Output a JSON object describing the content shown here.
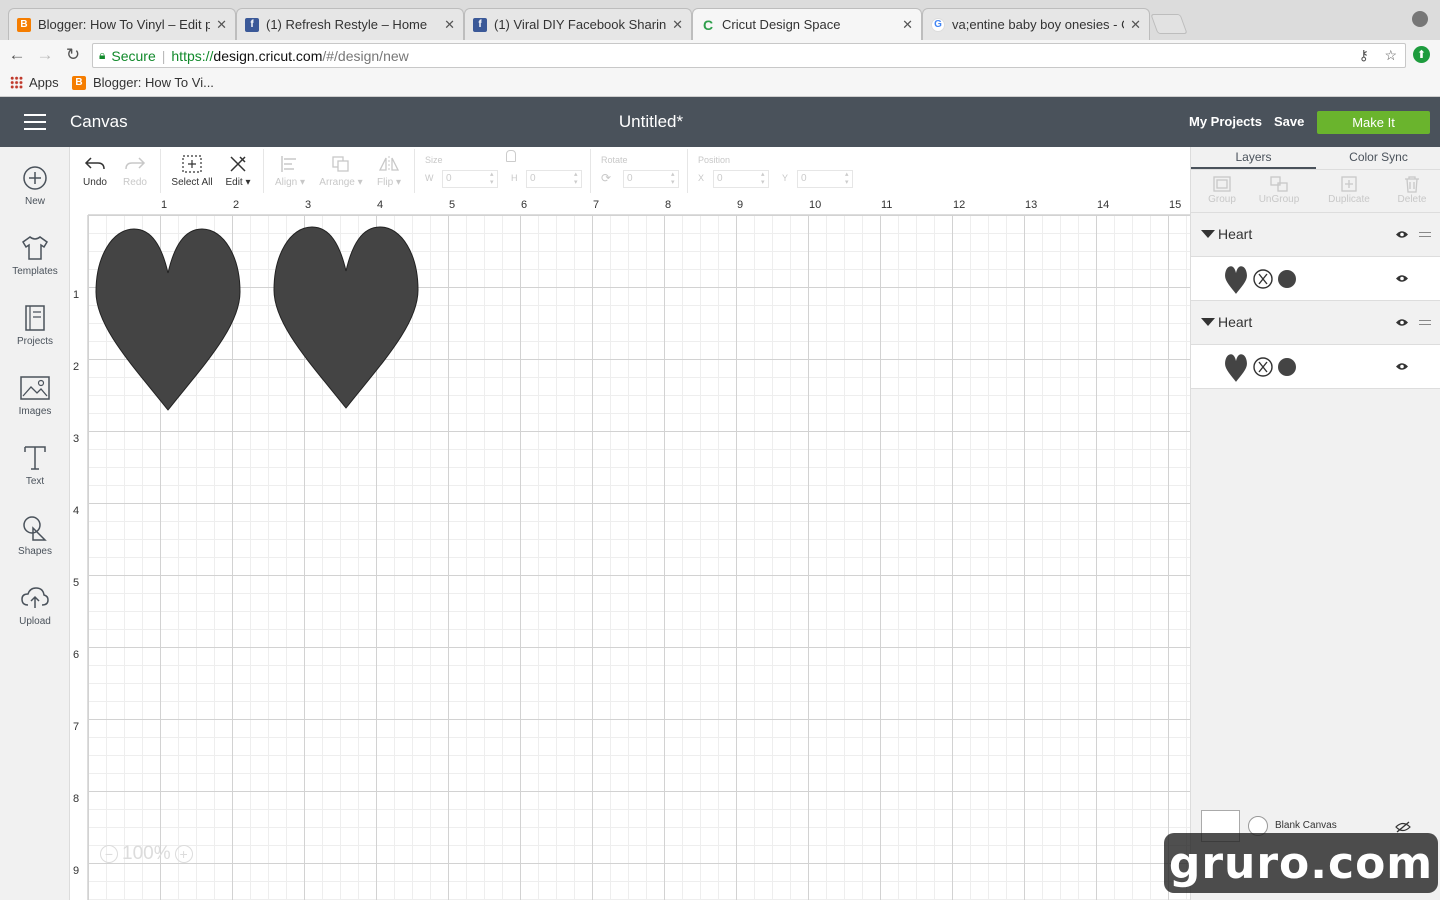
{
  "browser": {
    "tabs": [
      {
        "title": "Blogger: How To Vinyl – Edit p",
        "favicon": "blogger-icon",
        "color": "#f57d00"
      },
      {
        "title": "(1) Refresh Restyle – Home",
        "favicon": "facebook-icon",
        "color": "#3b5998"
      },
      {
        "title": "(1) Viral DIY Facebook Sharing",
        "favicon": "facebook-icon",
        "color": "#3b5998"
      },
      {
        "title": "Cricut Design Space",
        "favicon": "cricut-icon",
        "color": "#2e9e4b"
      },
      {
        "title": "va;entine baby boy onesies - G",
        "favicon": "google-icon",
        "color": "#4285f4"
      }
    ],
    "close_glyph": "✕",
    "address": {
      "secure_label": "Secure",
      "scheme": "https://",
      "host": "design.cricut.com",
      "path": "/#/design/new"
    },
    "bookmarks": {
      "apps_label": "Apps",
      "item_label": "Blogger: How To Vi..."
    }
  },
  "app": {
    "section_label": "Canvas",
    "document_title": "Untitled*",
    "my_projects_label": "My Projects",
    "save_label": "Save",
    "make_it_label": "Make It",
    "accent_color": "#6ab42d",
    "header_color": "#4a525b"
  },
  "left_tools": [
    {
      "label": "New",
      "icon": "plus-circle-icon"
    },
    {
      "label": "Templates",
      "icon": "tshirt-icon"
    },
    {
      "label": "Projects",
      "icon": "projects-icon"
    },
    {
      "label": "Images",
      "icon": "image-icon"
    },
    {
      "label": "Text",
      "icon": "text-icon"
    },
    {
      "label": "Shapes",
      "icon": "shapes-icon"
    },
    {
      "label": "Upload",
      "icon": "upload-cloud-icon"
    }
  ],
  "toolbar": {
    "undo_label": "Undo",
    "redo_label": "Redo",
    "select_all_label": "Select All",
    "edit_label": "Edit",
    "align_label": "Align",
    "arrange_label": "Arrange",
    "flip_label": "Flip",
    "size_label": "Size",
    "w_label": "W",
    "h_label": "H",
    "w_value": "0",
    "h_value": "0",
    "rotate_label": "Rotate",
    "rotate_value": "0",
    "position_label": "Position",
    "x_label": "X",
    "y_label": "Y",
    "x_value": "0",
    "y_value": "0"
  },
  "canvas": {
    "ruler_top": [
      "1",
      "2",
      "3",
      "4",
      "5",
      "6",
      "7",
      "8",
      "9",
      "10",
      "11",
      "12",
      "13",
      "14",
      "15"
    ],
    "ruler_left": [
      "1",
      "2",
      "3",
      "4",
      "5",
      "6",
      "7",
      "8",
      "9"
    ],
    "zoom_label": "100%",
    "shape_color": "#444444"
  },
  "layers_panel": {
    "tabs": [
      "Layers",
      "Color Sync"
    ],
    "tools": [
      "Group",
      "UnGroup",
      "Duplicate",
      "Delete"
    ],
    "groups": [
      {
        "name": "Heart"
      },
      {
        "name": "Heart"
      }
    ],
    "blank_canvas_label": "Blank Canvas"
  },
  "watermark": "gruro.com"
}
